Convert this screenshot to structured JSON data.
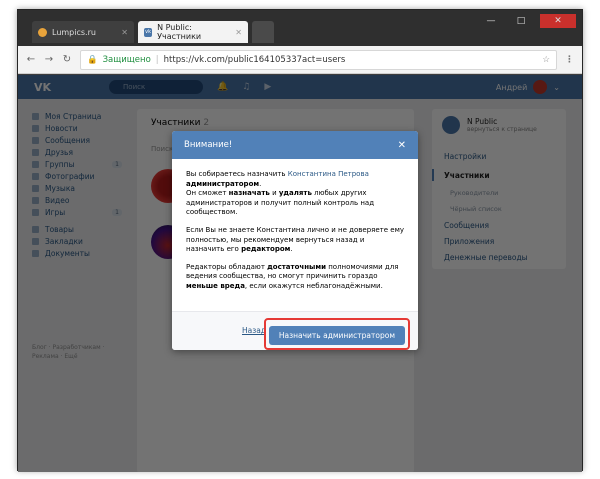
{
  "browser": {
    "tabs": [
      {
        "label": "Lumpics.ru"
      },
      {
        "label": "N Public: Участники"
      }
    ],
    "window_controls": {
      "minimize": "—",
      "maximize": "□",
      "close": "✕"
    },
    "address": {
      "secure_label": "Защищено",
      "url": "https://vk.com/public164105337act=users"
    }
  },
  "vk_header": {
    "logo": "VK",
    "search_placeholder": "Поиск",
    "user_name": "Андрей"
  },
  "left_menu": {
    "items": [
      {
        "label": "Моя Страница"
      },
      {
        "label": "Новости"
      },
      {
        "label": "Сообщения"
      },
      {
        "label": "Друзья"
      },
      {
        "label": "Группы",
        "count": "1"
      },
      {
        "label": "Фотографии"
      },
      {
        "label": "Музыка"
      },
      {
        "label": "Видео"
      },
      {
        "label": "Игры",
        "count": "1"
      },
      {
        "label": "Товары"
      },
      {
        "label": "Закладки"
      },
      {
        "label": "Документы"
      }
    ],
    "footer": "Блог · Разработчикам · Реклама · Ещё"
  },
  "main": {
    "title": "Участники",
    "count": "2",
    "search_placeholder": "Поиск"
  },
  "right_menu": {
    "group_name": "N Public",
    "group_sub": "вернуться к странице",
    "items": [
      "Настройки",
      "Участники",
      "Руководители",
      "Чёрный список",
      "Сообщения",
      "Приложения",
      "Денежные переводы"
    ]
  },
  "modal": {
    "title": "Внимание!",
    "p1_pre": "Вы собираетесь назначить ",
    "p1_link": "Константина Петрова",
    "p1_bold": "администратором",
    "p1_rest_a": "Он сможет ",
    "p1_bold2": "назначать",
    "p1_rest_b": " и ",
    "p1_bold3": "удалять",
    "p1_rest_c": " любых других администраторов и получит полный контроль над сообществом.",
    "p2_text": "Если Вы не знаете Константина лично и не доверяете ему полностью, мы рекомендуем вернуться назад и назначить его ",
    "p2_bold": "редактором",
    "p3_pre": "Редакторы обладают ",
    "p3_bold": "достаточными",
    "p3_mid": " полномочиями для ведения сообщества, но смогут причинить гораздо ",
    "p3_bold2": "меньше вреда",
    "p3_end": ", если окажутся неблагонадёжными.",
    "back_label": "Назад",
    "confirm_label": "Назначить администратором"
  }
}
